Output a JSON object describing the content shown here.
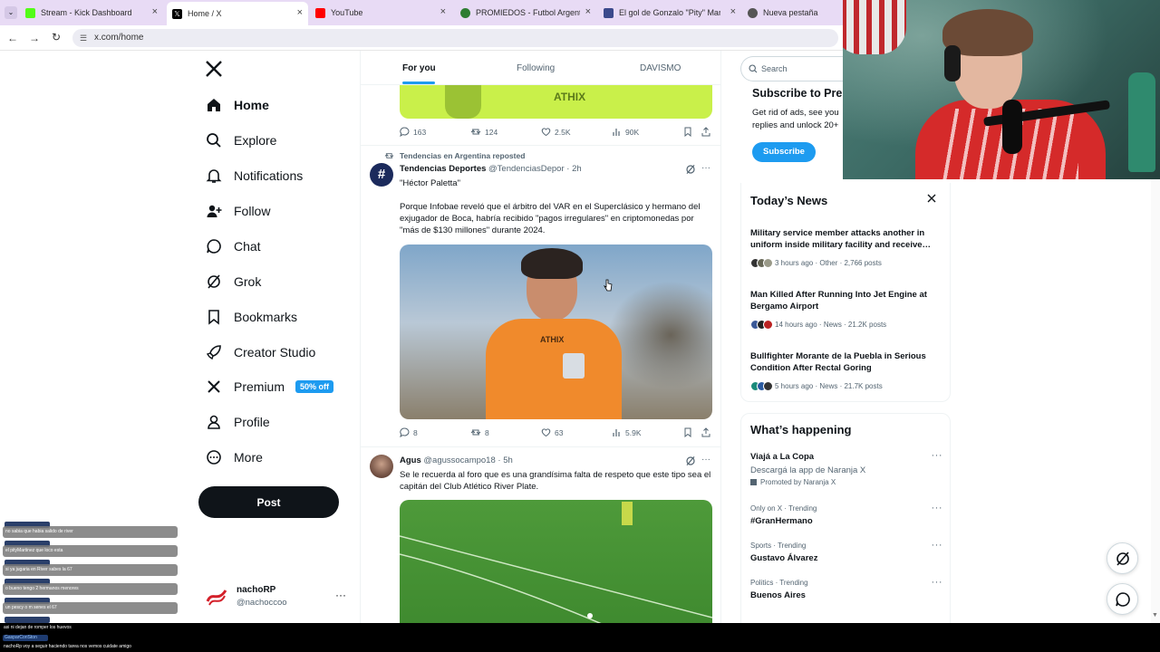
{
  "browser": {
    "tabs": [
      {
        "title": "Stream - Kick Dashboard",
        "color": "#53fc18"
      },
      {
        "title": "Home / X",
        "color": "#000000"
      },
      {
        "title": "YouTube",
        "color": "#ff0000"
      },
      {
        "title": "PROMIEDOS - Futbol Argentino",
        "color": "#2e7d32"
      },
      {
        "title": "El gol de Gonzalo \"Pity\" Martínez",
        "color": "#3b4a8c"
      },
      {
        "title": "Nueva pestaña",
        "color": "#555555"
      }
    ],
    "url": "x.com/home"
  },
  "nav": {
    "items": [
      {
        "label": "Home",
        "icon": "home-icon"
      },
      {
        "label": "Explore",
        "icon": "search-icon"
      },
      {
        "label": "Notifications",
        "icon": "bell-icon"
      },
      {
        "label": "Follow",
        "icon": "add-person-icon"
      },
      {
        "label": "Chat",
        "icon": "chat-icon"
      },
      {
        "label": "Grok",
        "icon": "grok-icon"
      },
      {
        "label": "Bookmarks",
        "icon": "bookmark-icon"
      },
      {
        "label": "Creator Studio",
        "icon": "rocket-icon"
      },
      {
        "label": "Premium",
        "icon": "x-logo-icon"
      },
      {
        "label": "Profile",
        "icon": "person-icon"
      },
      {
        "label": "More",
        "icon": "more-circle-icon"
      }
    ],
    "premium_badge": "50% off",
    "post_label": "Post",
    "account": {
      "name": "nachoRP",
      "handle": "@nachoccoo"
    }
  },
  "feed": {
    "tabs": [
      "For you",
      "Following",
      "DAVISMO"
    ],
    "tweet0_actions": {
      "replies": "163",
      "reposts": "124",
      "likes": "2.5K",
      "views": "90K"
    },
    "tweet1": {
      "reposted_by": "Tendencias en Argentina reposted",
      "name": "Tendencias Deportes",
      "handle": "@TendenciasDepor",
      "time": "· 2h",
      "title": "\"Héctor Paletta\"",
      "text": "Porque Infobae reveló que el árbitro del VAR en el Superclásico y hermano del exjugador de Boca, habría recibido \"pagos irregulares\" en criptomonedas por \"más de $130 millones\" durante 2024.",
      "replies": "8",
      "reposts": "8",
      "likes": "63",
      "views": "5.9K"
    },
    "tweet2": {
      "name": "Agus",
      "handle": "@agussocampo18",
      "time": "· 5h",
      "text": "Se le recuerda al foro que es una grandísima falta de respeto que este tipo sea el capitán del Club Atlético River Plate."
    }
  },
  "right": {
    "search_placeholder": "Search",
    "subscribe": {
      "title": "Subscribe to Pre",
      "line1": "Get rid of ads, see you",
      "line2": "replies and unlock 20+",
      "button": "Subscribe"
    },
    "todays_news": {
      "title": "Today’s News",
      "items": [
        {
          "headline": "Military service member attacks another in uniform inside military facility and receive…",
          "meta": "3 hours ago · Other · 2,766 posts"
        },
        {
          "headline": "Man Killed After Running Into Jet Engine at Bergamo Airport",
          "meta": "14 hours ago · News · 21.2K posts"
        },
        {
          "headline": "Bullfighter Morante de la Puebla in Serious Condition After Rectal Goring",
          "meta": "5 hours ago · News · 21.7K posts"
        }
      ]
    },
    "whats_happening": {
      "title": "What’s happening",
      "promo": {
        "title": "Viajá a La Copa",
        "sub": "Descargá la app de Naranja X",
        "promoted": "Promoted by Naranja X"
      },
      "trends": [
        {
          "context": "Only on X · Trending",
          "name": "#GranHermano"
        },
        {
          "context": "Sports · Trending",
          "name": "Gustavo Álvarez"
        },
        {
          "context": "Politics · Trending",
          "name": "Buenos Aires"
        }
      ]
    }
  },
  "overlay_chat": [
    "no sabia que habia salido de river",
    "el pityMartinez que loco esta",
    "si ya jugaria en River sabes la 67",
    "o bueno tengo 2 hermanos menores",
    "un pescy o m senes el 67",
    "asi ni dejan de romper los huevos",
    "nachoRp voy a seguir haciendo tarea nos vemos cuidate amigo"
  ],
  "overlay_chat_user": "GasparCoriSton"
}
